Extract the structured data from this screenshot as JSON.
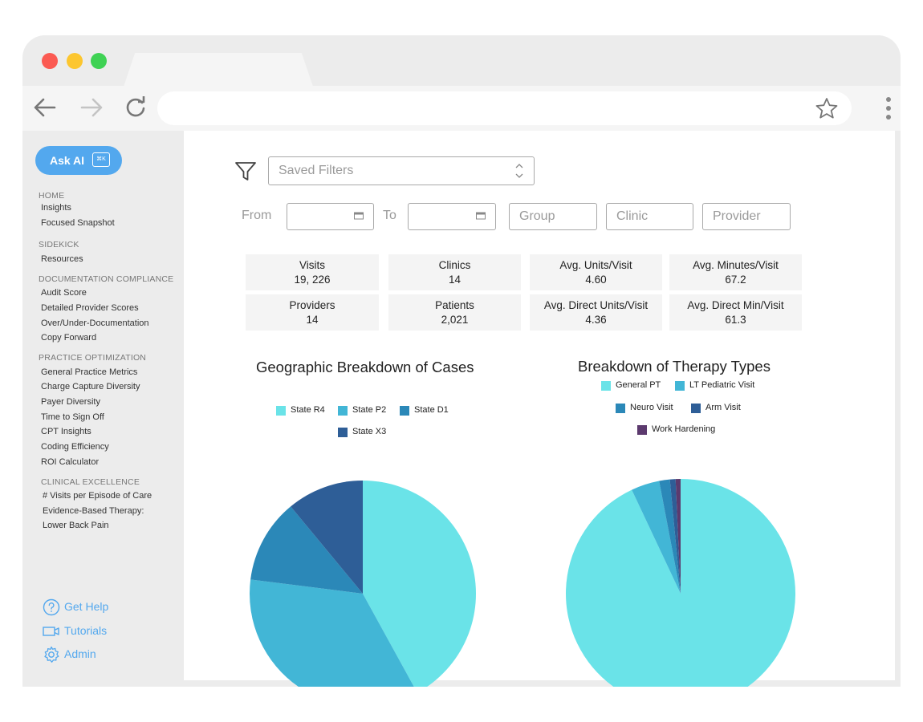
{
  "sidebar": {
    "ask_ai": {
      "label": "Ask AI",
      "shortcut": "⌘K"
    },
    "sections": [
      {
        "title": "HOME",
        "items": [
          "Insights",
          "Focused Snapshot"
        ]
      },
      {
        "title": "SIDEKICK",
        "items": [
          "Resources"
        ]
      },
      {
        "title": "DOCUMENTATION COMPLIANCE",
        "items": [
          "Audit Score",
          "Detailed Provider Scores",
          "Over/Under-Documentation",
          "Copy Forward"
        ]
      },
      {
        "title": "PRACTICE OPTIMIZATION",
        "items": [
          "General Practice Metrics",
          "Charge Capture Diversity",
          "Payer Diversity",
          "Time to Sign Off",
          "CPT Insights",
          "Coding Efficiency",
          "ROI Calculator"
        ]
      },
      {
        "title": "CLINICAL EXCELLENCE",
        "items": [
          "# Visits per Episode of Care",
          "Evidence-Based Therapy:",
          "Lower Back Pain"
        ]
      }
    ],
    "footer": {
      "help": "Get Help",
      "tutorials": "Tutorials",
      "admin": "Admin"
    }
  },
  "filters": {
    "saved_filters_placeholder": "Saved Filters",
    "from_label": "From",
    "to_label": "To",
    "group_placeholder": "Group",
    "clinic_placeholder": "Clinic",
    "provider_placeholder": "Provider"
  },
  "stats": [
    {
      "label": "Visits",
      "value": "19, 226"
    },
    {
      "label": "Clinics",
      "value": "14"
    },
    {
      "label": "Avg. Units/Visit",
      "value": "4.60"
    },
    {
      "label": "Avg. Minutes/Visit",
      "value": "67.2"
    },
    {
      "label": "Providers",
      "value": "14"
    },
    {
      "label": "Patients",
      "value": "2,021"
    },
    {
      "label": "Avg. Direct Units/Visit",
      "value": "4.36"
    },
    {
      "label": "Avg. Direct Min/Visit",
      "value": "61.3"
    }
  ],
  "chart_data": [
    {
      "type": "pie",
      "title": "Geographic Breakdown of Cases",
      "categories": [
        "State R4",
        "State P2",
        "State D1",
        "State X3"
      ],
      "values": [
        42,
        35,
        12,
        11
      ],
      "colors": [
        "#6ae3e8",
        "#42b6d6",
        "#2b88b8",
        "#2e5e97"
      ],
      "legend": "top"
    },
    {
      "type": "pie",
      "title": "Breakdown of Therapy Types",
      "categories": [
        "General PT",
        "LT Pediatric Visit",
        "Neuro Visit",
        "Arm Visit",
        "Work Hardening"
      ],
      "values": [
        93,
        4,
        1.5,
        0.8,
        0.7
      ],
      "colors": [
        "#6ae3e8",
        "#42b6d6",
        "#2b88b8",
        "#2e5e97",
        "#5c3a6e"
      ],
      "legend": "top"
    }
  ]
}
